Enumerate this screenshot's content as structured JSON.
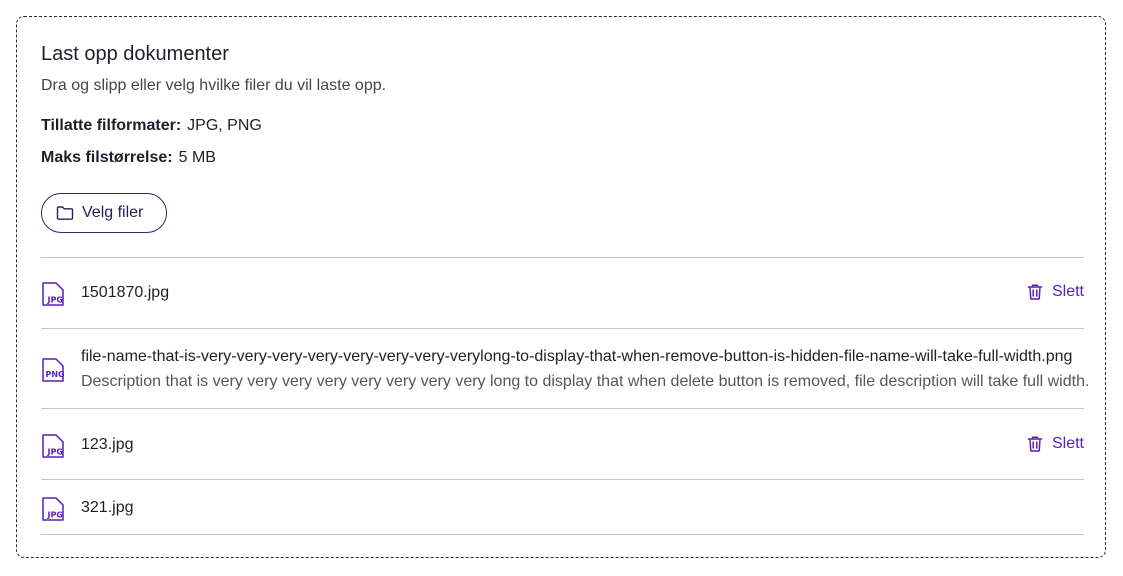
{
  "upload": {
    "title": "Last opp dokumenter",
    "subtitle": "Dra og slipp eller velg hvilke filer du vil laste opp.",
    "formats_label": "Tillatte filformater:",
    "formats_value": "JPG, PNG",
    "size_label": "Maks filstørrelse:",
    "size_value": "5 MB",
    "choose_button": "Velg filer",
    "accent_color": "#5a1fb5",
    "button_border_color": "#2a2a6e"
  },
  "files": [
    {
      "icon": "jpg-file-icon",
      "icon_text": "JPG",
      "name": "1501870.jpg",
      "delete_label": "Slett"
    },
    {
      "icon": "png-file-icon",
      "icon_text": "PNG",
      "name": "file-name-that-is-very-very-very-very-very-very-very-verylong-to-display-that-when-remove-button-is-hidden-file-name-will-take-full-width.png",
      "description": "Description that is very very very very very very very very long to display that when delete button is removed, file description will take full width."
    },
    {
      "icon": "jpg-file-icon",
      "icon_text": "JPG",
      "name": "123.jpg",
      "delete_label": "Slett"
    },
    {
      "icon": "jpg-file-icon",
      "icon_text": "JPG",
      "name": "321.jpg"
    }
  ]
}
